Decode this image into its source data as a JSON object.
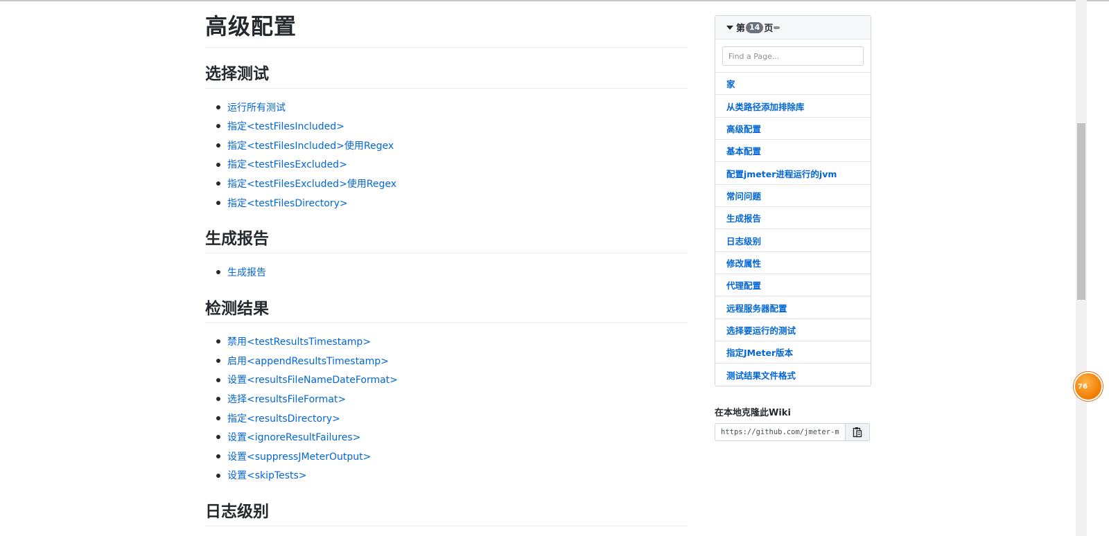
{
  "page": {
    "title": "高级配置"
  },
  "sections": [
    {
      "title": "选择测试",
      "links": [
        "运行所有测试",
        "指定<testFilesIncluded>",
        "指定<testFilesIncluded>使用Regex",
        "指定<testFilesExcluded>",
        "指定<testFilesExcluded>使用Regex",
        "指定<testFilesDirectory>"
      ]
    },
    {
      "title": "生成报告",
      "links": [
        "生成报告"
      ]
    },
    {
      "title": "检测结果",
      "links": [
        "禁用<testResultsTimestamp>",
        "启用<appendResultsTimestamp>",
        "设置<resultsFileNameDateFormat>",
        "选择<resultsFileFormat>",
        "指定<resultsDirectory>",
        "设置<ignoreResultFailures>",
        "设置<suppressJMeterOutput>",
        "设置<skipTests>"
      ]
    },
    {
      "title": "日志级别",
      "links": []
    }
  ],
  "sidebar": {
    "header_prefix": "第",
    "page_count": "14",
    "header_suffix": "页",
    "search_placeholder": "Find a Page...",
    "pages": [
      "家",
      "从类路径添加排除库",
      "高级配置",
      "基本配置",
      "配置jmeter进程运行的jvm",
      "常问问题",
      "生成报告",
      "日志级别",
      "修改属性",
      "代理配置",
      "远程服务器配置",
      "选择要运行的测试",
      "指定JMeter版本",
      "测试结果文件格式"
    ]
  },
  "clone": {
    "title": "在本地克隆此Wiki",
    "url": "https://github.com/jmeter-m"
  },
  "floating_badge": {
    "text": "76"
  },
  "colors": {
    "link": "#0366d6",
    "text": "#24292e",
    "border": "#e1e4e8",
    "badge": "#f07b00"
  }
}
